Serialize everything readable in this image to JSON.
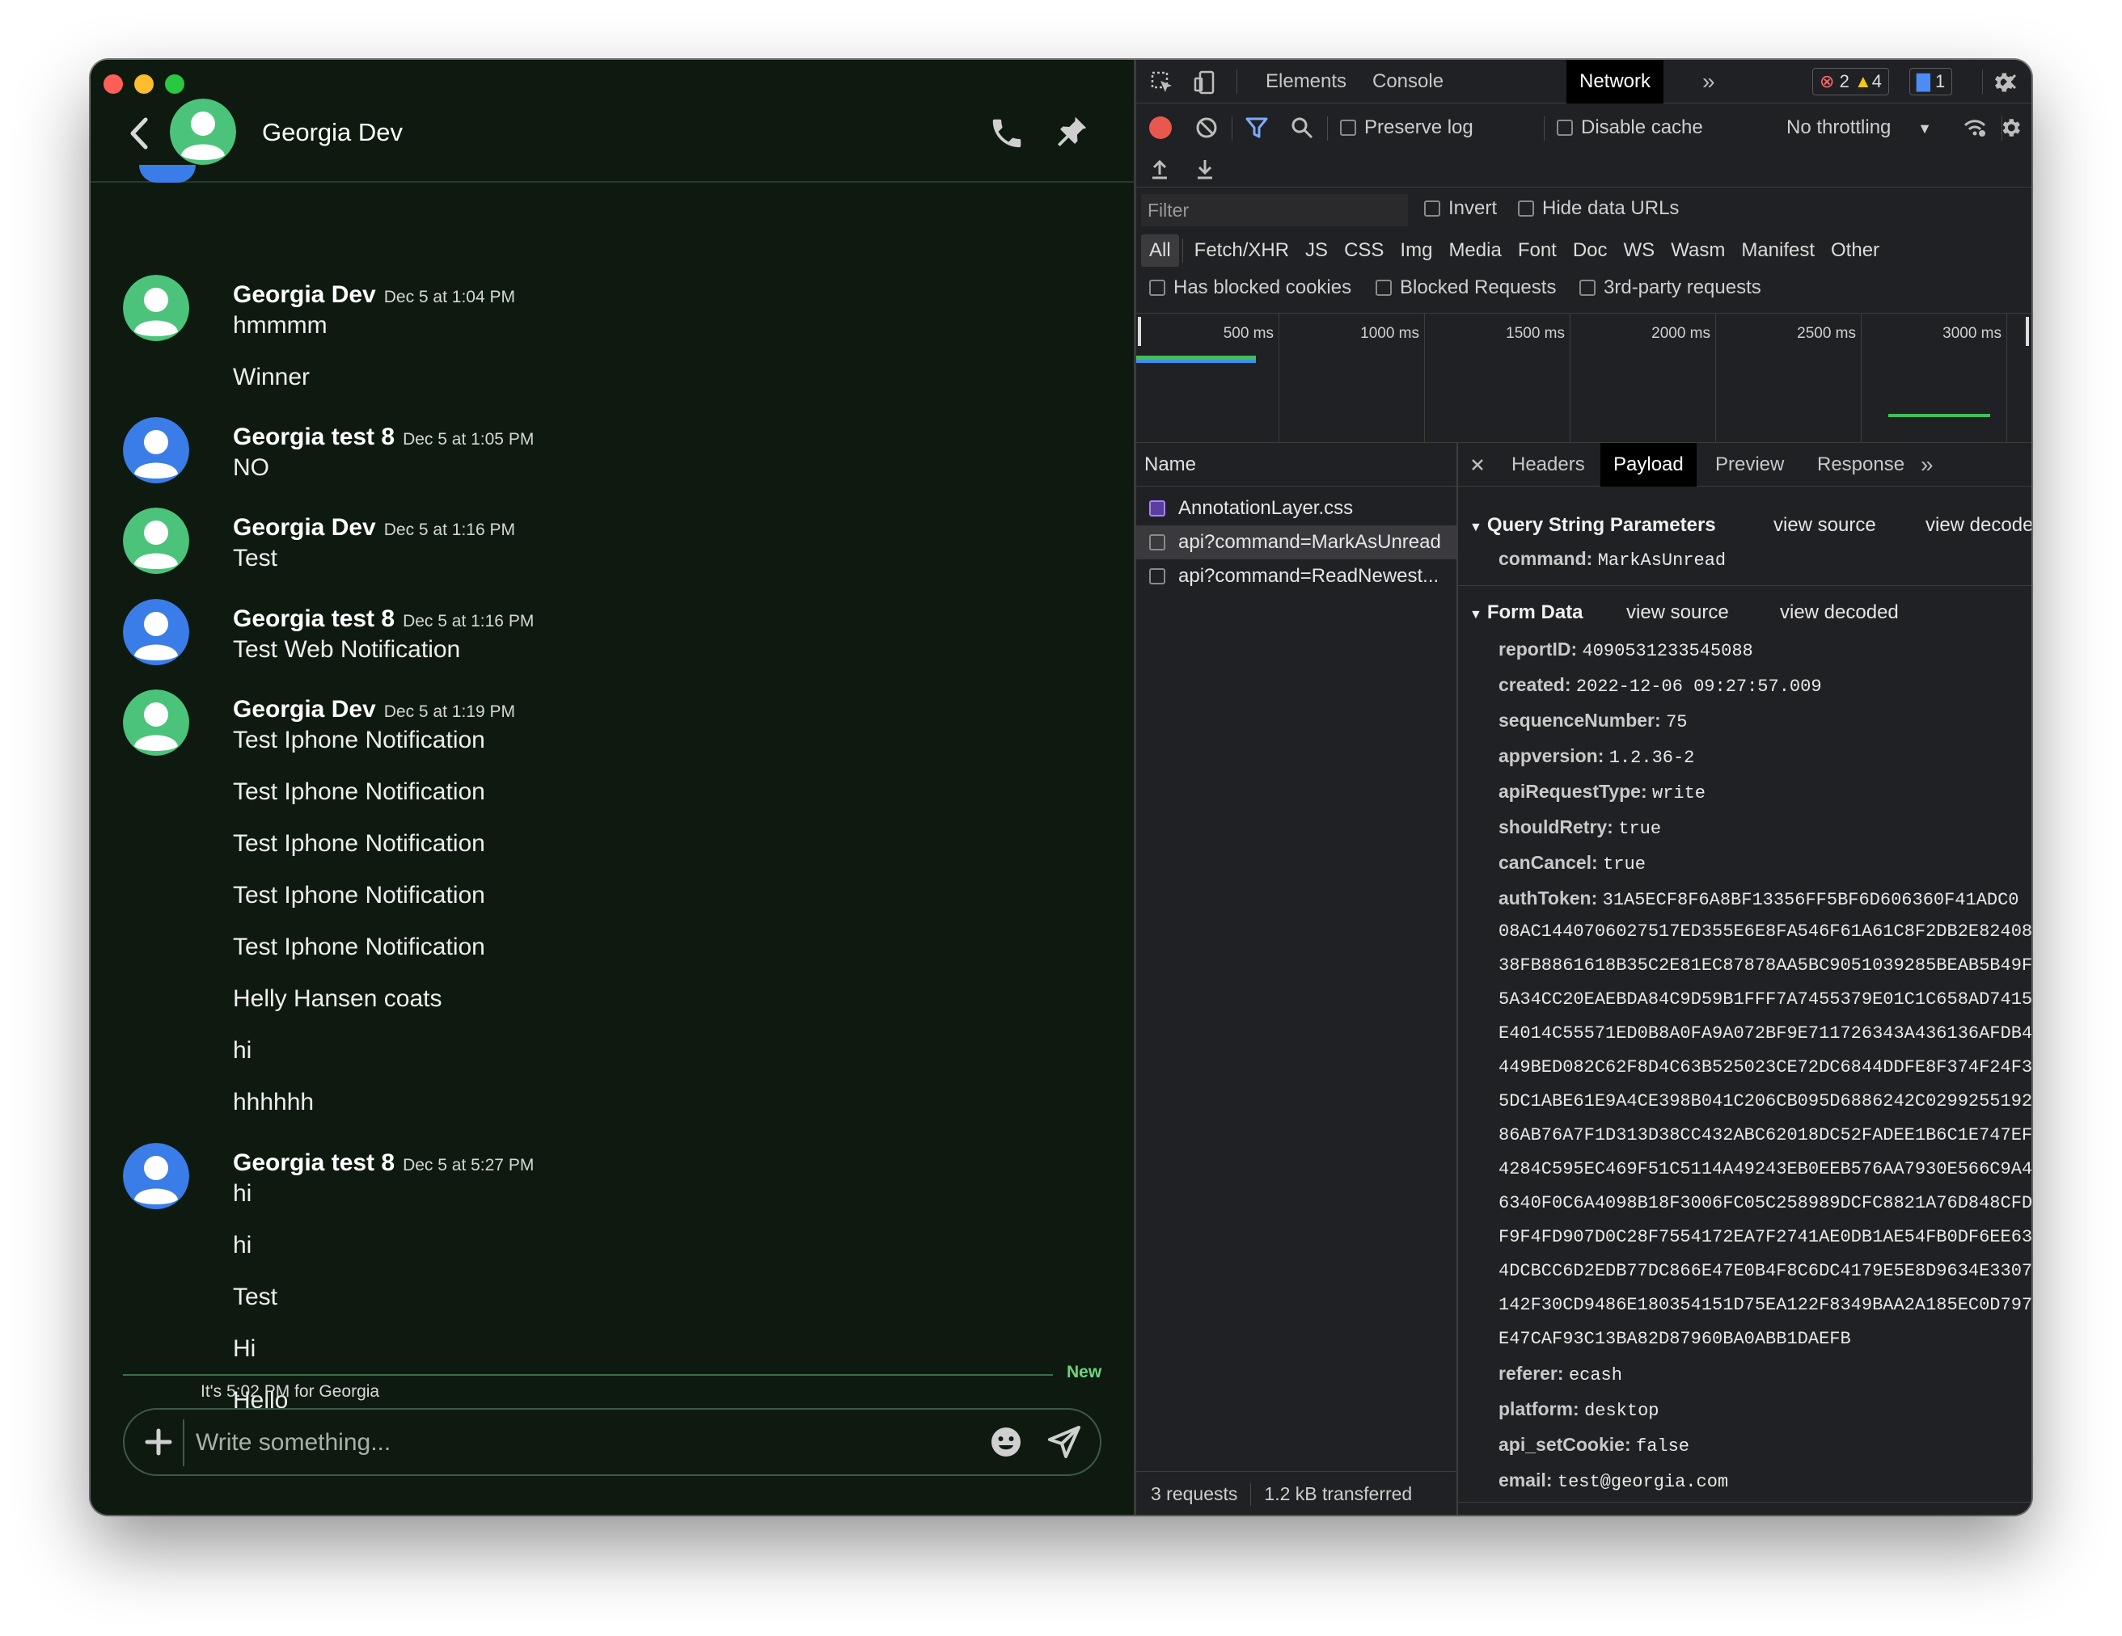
{
  "chat": {
    "contact_name": "Georgia Dev",
    "messages": [
      {
        "author": "Georgia Dev",
        "time": "Dec 5 at 1:04 PM",
        "avatar": "green",
        "lines": [
          "hmmmm",
          "Winner"
        ]
      },
      {
        "author": "Georgia test 8",
        "time": "Dec 5 at 1:05 PM",
        "avatar": "blue",
        "lines": [
          "NO"
        ]
      },
      {
        "author": "Georgia Dev",
        "time": "Dec 5 at 1:16 PM",
        "avatar": "green",
        "lines": [
          "Test"
        ]
      },
      {
        "author": "Georgia test 8",
        "time": "Dec 5 at 1:16 PM",
        "avatar": "blue",
        "lines": [
          "Test Web Notification"
        ]
      },
      {
        "author": "Georgia Dev",
        "time": "Dec 5 at 1:19 PM",
        "avatar": "green",
        "lines": [
          "Test Iphone Notification",
          "Test Iphone Notification",
          "Test Iphone Notification",
          "Test Iphone Notification",
          "Test Iphone Notification",
          "Helly Hansen coats",
          "hi",
          "hhhhhh"
        ]
      },
      {
        "author": "Georgia test 8",
        "time": "Dec 5 at 5:27 PM",
        "avatar": "blue",
        "lines": [
          "hi",
          "hi",
          "Test",
          "Hi",
          "Hello"
        ]
      }
    ],
    "new_label": "New",
    "local_time": "It's 5:02 PM for Georgia",
    "composer_placeholder": "Write something..."
  },
  "colors": {
    "avatar_green": "#4cc37a",
    "avatar_blue": "#3a7de8",
    "traffic_red": "#ff5f57",
    "traffic_yellow": "#febc2e",
    "traffic_green": "#28c840"
  },
  "devtools": {
    "tabs": [
      "Elements",
      "Console",
      "Network"
    ],
    "active_tab": "Network",
    "errors": "2",
    "warnings": "4",
    "messages": "1",
    "toolbar": {
      "preserve_log": "Preserve log",
      "disable_cache": "Disable cache",
      "throttling": "No throttling"
    },
    "filter": {
      "placeholder": "Filter",
      "invert": "Invert",
      "hide_data_urls": "Hide data URLs",
      "types": [
        "All",
        "Fetch/XHR",
        "JS",
        "CSS",
        "Img",
        "Media",
        "Font",
        "Doc",
        "WS",
        "Wasm",
        "Manifest",
        "Other"
      ],
      "has_blocked_cookies": "Has blocked cookies",
      "blocked_requests": "Blocked Requests",
      "third_party": "3rd-party requests"
    },
    "timeline_labels": [
      "500 ms",
      "1000 ms",
      "1500 ms",
      "2000 ms",
      "2500 ms",
      "3000 ms"
    ],
    "requests": {
      "header": "Name",
      "items": [
        "AnnotationLayer.css",
        "api?command=MarkAsUnread",
        "api?command=ReadNewest..."
      ],
      "count": "3 requests",
      "transferred": "1.2 kB transferred"
    },
    "detail_tabs": [
      "Headers",
      "Payload",
      "Preview",
      "Response"
    ],
    "active_detail_tab": "Payload",
    "query": {
      "title": "Query String Parameters",
      "view_source": "view source",
      "view_decoded": "view decoded",
      "params": [
        {
          "k": "command:",
          "v": "MarkAsUnread"
        }
      ]
    },
    "form": {
      "title": "Form Data",
      "view_source": "view source",
      "view_decoded": "view decoded",
      "fields_top": [
        {
          "k": "reportID:",
          "v": "4090531233545088"
        },
        {
          "k": "created:",
          "v": "2022-12-06 09:27:57.009"
        },
        {
          "k": "sequenceNumber:",
          "v": "75"
        },
        {
          "k": "appversion:",
          "v": "1.2.36-2"
        },
        {
          "k": "apiRequestType:",
          "v": "write"
        },
        {
          "k": "shouldRetry:",
          "v": "true"
        },
        {
          "k": "canCancel:",
          "v": "true"
        }
      ],
      "auth_token_key": "authToken:",
      "auth_token_lines": [
        "31A5ECF8F6A8BF13356FF5BF6D606360F41ADC0",
        "08AC1440706027517ED355E6E8FA546F61A61C8F2DB2E82408",
        "38FB8861618B35C2E81EC87878AA5BC9051039285BEAB5B49F",
        "5A34CC20EAEBDA84C9D59B1FFF7A7455379E01C1C658AD7415",
        "E4014C55571ED0B8A0FA9A072BF9E711726343A436136AFDB4",
        "449BED082C62F8D4C63B525023CE72DC6844DDFE8F374F24F3",
        "5DC1ABE61E9A4CE398B041C206CB095D6886242C0299255192",
        "86AB76A7F1D313D38CC432ABC62018DC52FADEE1B6C1E747EF",
        "4284C595EC469F51C5114A49243EB0EEB576AA7930E566C9A4",
        "6340F0C6A4098B18F3006FC05C258989DCFC8821A76D848CFD",
        "F9F4FD907D0C28F7554172EA7F2741AE0DB1AE54FB0DF6EE63",
        "4DCBCC6D2EDB77DC866E47E0B4F8C6DC4179E5E8D9634E3307",
        "142F30CD9486E180354151D75EA122F8349BAA2A185EC0D797",
        "E47CAF93C13BA82D87960BA0ABB1DAEFB"
      ],
      "fields_bottom": [
        {
          "k": "referer:",
          "v": "ecash"
        },
        {
          "k": "platform:",
          "v": "desktop"
        },
        {
          "k": "api_setCookie:",
          "v": "false"
        },
        {
          "k": "email:",
          "v": "test@georgia.com"
        }
      ]
    }
  }
}
